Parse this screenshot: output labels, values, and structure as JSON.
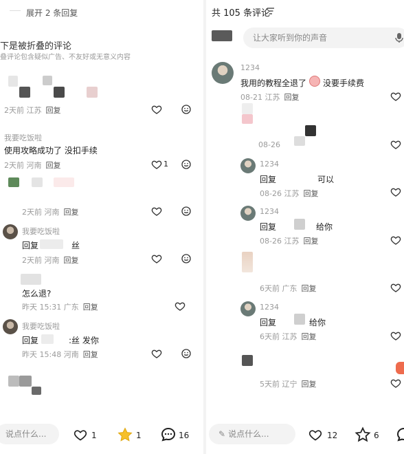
{
  "left": {
    "expand_label": "展开 2 条回复",
    "folded_title": "下是被折叠的评论",
    "folded_desc": "叠评论包含疑似广告、不友好或无意义内容",
    "comments": [
      {
        "meta_time": "2天前",
        "meta_loc": "江苏",
        "reply": "回复"
      },
      {
        "name": "我要吃饭啦",
        "text": "使用攻略成功了 没扣手续",
        "meta_time": "2天前",
        "meta_loc": "河南",
        "reply": "回复",
        "likes": "1"
      },
      {
        "meta_time": "2天前",
        "meta_loc": "河南",
        "reply": "回复"
      },
      {
        "name": "我要吃饭啦",
        "text_prefix": "回复",
        "text_suffix": "丝",
        "meta_time": "2天前",
        "meta_loc": "河南",
        "reply": "回复"
      },
      {
        "text": "怎么退?",
        "meta_time": "昨天 15:31",
        "meta_loc": "广东",
        "reply": "回复"
      },
      {
        "name": "我要吃饭啦",
        "text_prefix": "回复",
        "text_suffix": ":丝 发你",
        "meta_time": "昨天 15:48",
        "meta_loc": "河南",
        "reply": "回复"
      }
    ],
    "bottom": {
      "placeholder": "说点什么...",
      "like_count": "1",
      "star_count": "1",
      "comment_count": "16"
    }
  },
  "right": {
    "header_title": "共 105 条评论",
    "search_placeholder": "让大家听到你的声音",
    "comments": [
      {
        "name": "1234",
        "text": "我用的教程全退了",
        "text2": "没要手续费",
        "meta_time": "08-21",
        "meta_loc": "江苏",
        "reply": "回复"
      },
      {
        "meta_time": "08-26",
        "reply": ""
      },
      {
        "name": "1234",
        "text_prefix": "回复",
        "text_suffix": "可以",
        "meta_time": "08-26",
        "meta_loc": "江苏",
        "reply": "回复"
      },
      {
        "name": "1234",
        "text_prefix": "回复",
        "text_suffix": "给你",
        "meta_time": "08-26",
        "meta_loc": "江苏",
        "reply": "回复"
      },
      {
        "meta_time": "6天前",
        "meta_loc": "广东",
        "reply": "回复"
      },
      {
        "name": "1234",
        "text_prefix": "回复",
        "text_suffix": "给你",
        "meta_time": "6天前",
        "meta_loc": "江苏",
        "reply": "回复"
      },
      {
        "meta_time": "5天前",
        "meta_loc": "辽宁",
        "reply": "回复"
      }
    ],
    "bottom": {
      "placeholder": "说点什么...",
      "like_count": "12",
      "star_count": "6"
    }
  }
}
